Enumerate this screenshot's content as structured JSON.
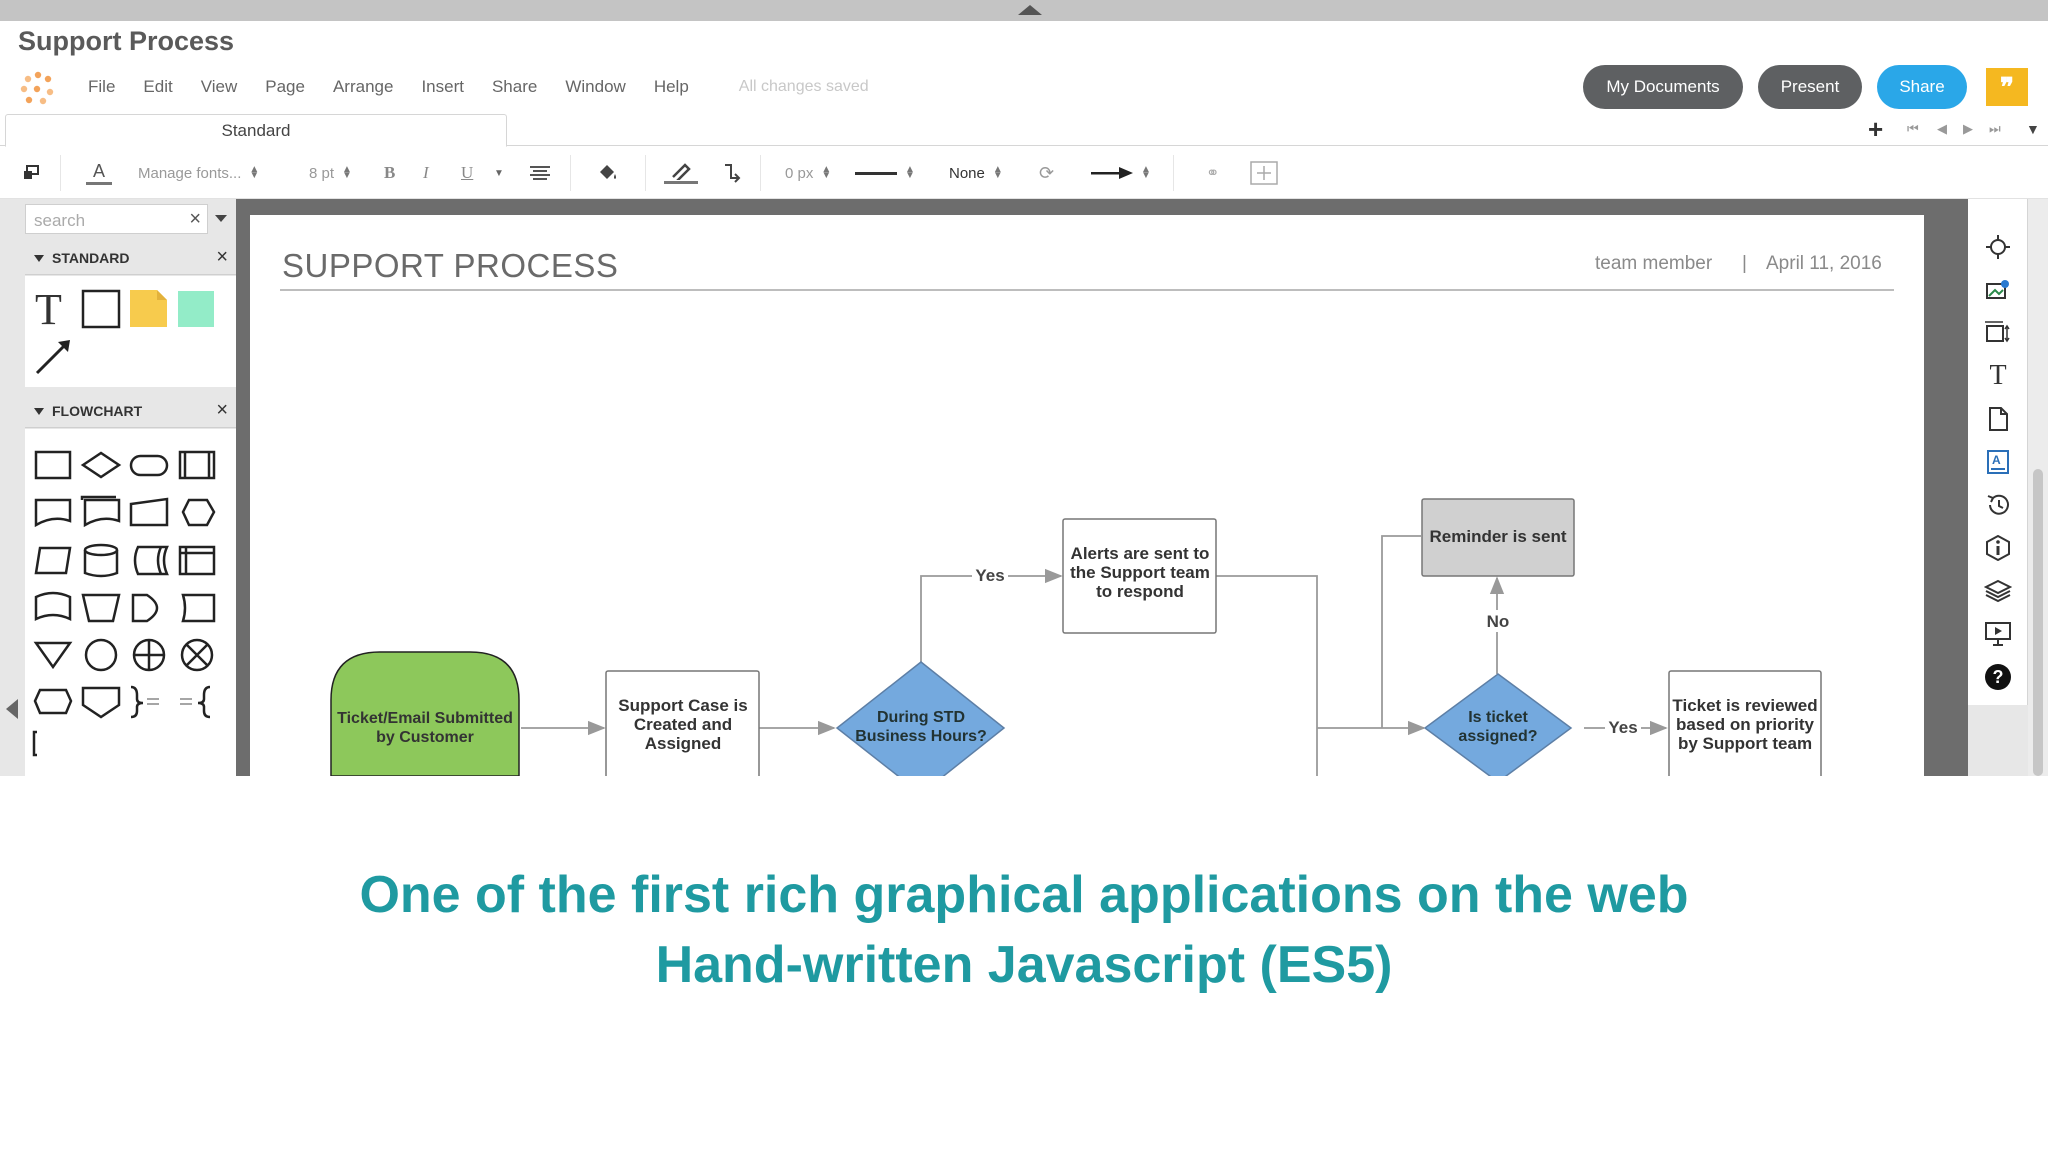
{
  "document_title": "Support Process",
  "menu": {
    "items": [
      "File",
      "Edit",
      "View",
      "Page",
      "Arrange",
      "Insert",
      "Share",
      "Window",
      "Help"
    ],
    "status": "All changes saved"
  },
  "header_buttons": {
    "my_documents": "My Documents",
    "present": "Present",
    "share": "Share",
    "feedback_glyph": "❞"
  },
  "tabs": {
    "active": "Standard",
    "add_glyph": "+"
  },
  "toolbar": {
    "font_picker": "Manage fonts...",
    "font_size": "8 pt",
    "bold": "B",
    "italic": "I",
    "underline": "U",
    "line_width": "0 px",
    "line_end": "None"
  },
  "left_panel": {
    "search_placeholder": "search",
    "sections": [
      {
        "title": "STANDARD"
      },
      {
        "title": "FLOWCHART"
      }
    ]
  },
  "page": {
    "title": "SUPPORT PROCESS",
    "author": "team member",
    "separator": "|",
    "date": "April 11, 2016"
  },
  "flowchart": {
    "start": [
      "Ticket/Email Submitted",
      "by Customer"
    ],
    "created": [
      "Support Case is",
      "Created and",
      "Assigned"
    ],
    "during_hours": [
      "During STD",
      "Business Hours?"
    ],
    "alerts": [
      "Alerts are sent to",
      "the Support team",
      "to respond"
    ],
    "reminder": "Reminder is sent",
    "is_assigned": [
      "Is ticket",
      "assigned?"
    ],
    "reviewed": [
      "Ticket is reviewed",
      "based on priority",
      "by Support team"
    ],
    "label_yes": "Yes",
    "label_no": "No"
  },
  "colors": {
    "start_fill": "#8dc85b",
    "decision_fill": "#74a9de",
    "reminder_fill": "#d0d0d0",
    "share_button": "#2aa7e8",
    "caption": "#1f9aa1"
  },
  "caption": {
    "line1": "One of the first rich graphical applications on the web",
    "line2": "Hand-written Javascript (ES5)"
  }
}
